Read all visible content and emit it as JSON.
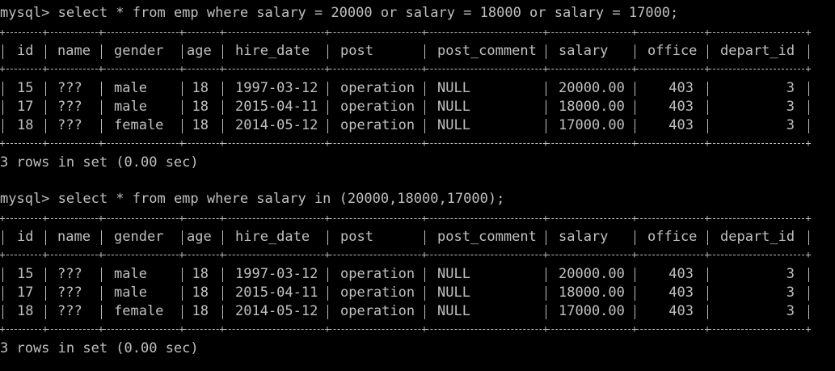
{
  "prompt": "mysql>",
  "blocks": [
    {
      "command": " select * from emp where salary = 20000 or salary = 18000 or salary = 17000;",
      "columns": [
        "id",
        "name",
        "gender",
        "age",
        "hire_date",
        "post",
        "post_comment",
        "salary",
        "office",
        "depart_id"
      ],
      "rows": [
        [
          "15",
          "???",
          "male",
          "18",
          "1997-03-12",
          "operation",
          "NULL",
          "20000.00",
          "403",
          "3"
        ],
        [
          "17",
          "???",
          "male",
          "18",
          "2015-04-11",
          "operation",
          "NULL",
          "18000.00",
          "403",
          "3"
        ],
        [
          "18",
          "???",
          "female",
          "18",
          "2014-05-12",
          "operation",
          "NULL",
          "17000.00",
          "403",
          "3"
        ]
      ],
      "footer": "3 rows in set (0.00 sec)"
    },
    {
      "command": " select * from emp where salary in (20000,18000,17000);",
      "columns": [
        "id",
        "name",
        "gender",
        "age",
        "hire_date",
        "post",
        "post_comment",
        "salary",
        "office",
        "depart_id"
      ],
      "rows": [
        [
          "15",
          "???",
          "male",
          "18",
          "1997-03-12",
          "operation",
          "NULL",
          "20000.00",
          "403",
          "3"
        ],
        [
          "17",
          "???",
          "male",
          "18",
          "2015-04-11",
          "operation",
          "NULL",
          "18000.00",
          "403",
          "3"
        ],
        [
          "18",
          "???",
          "female",
          "18",
          "2014-05-12",
          "operation",
          "NULL",
          "17000.00",
          "403",
          "3"
        ]
      ],
      "footer": "3 rows in set (0.00 sec)"
    }
  ]
}
